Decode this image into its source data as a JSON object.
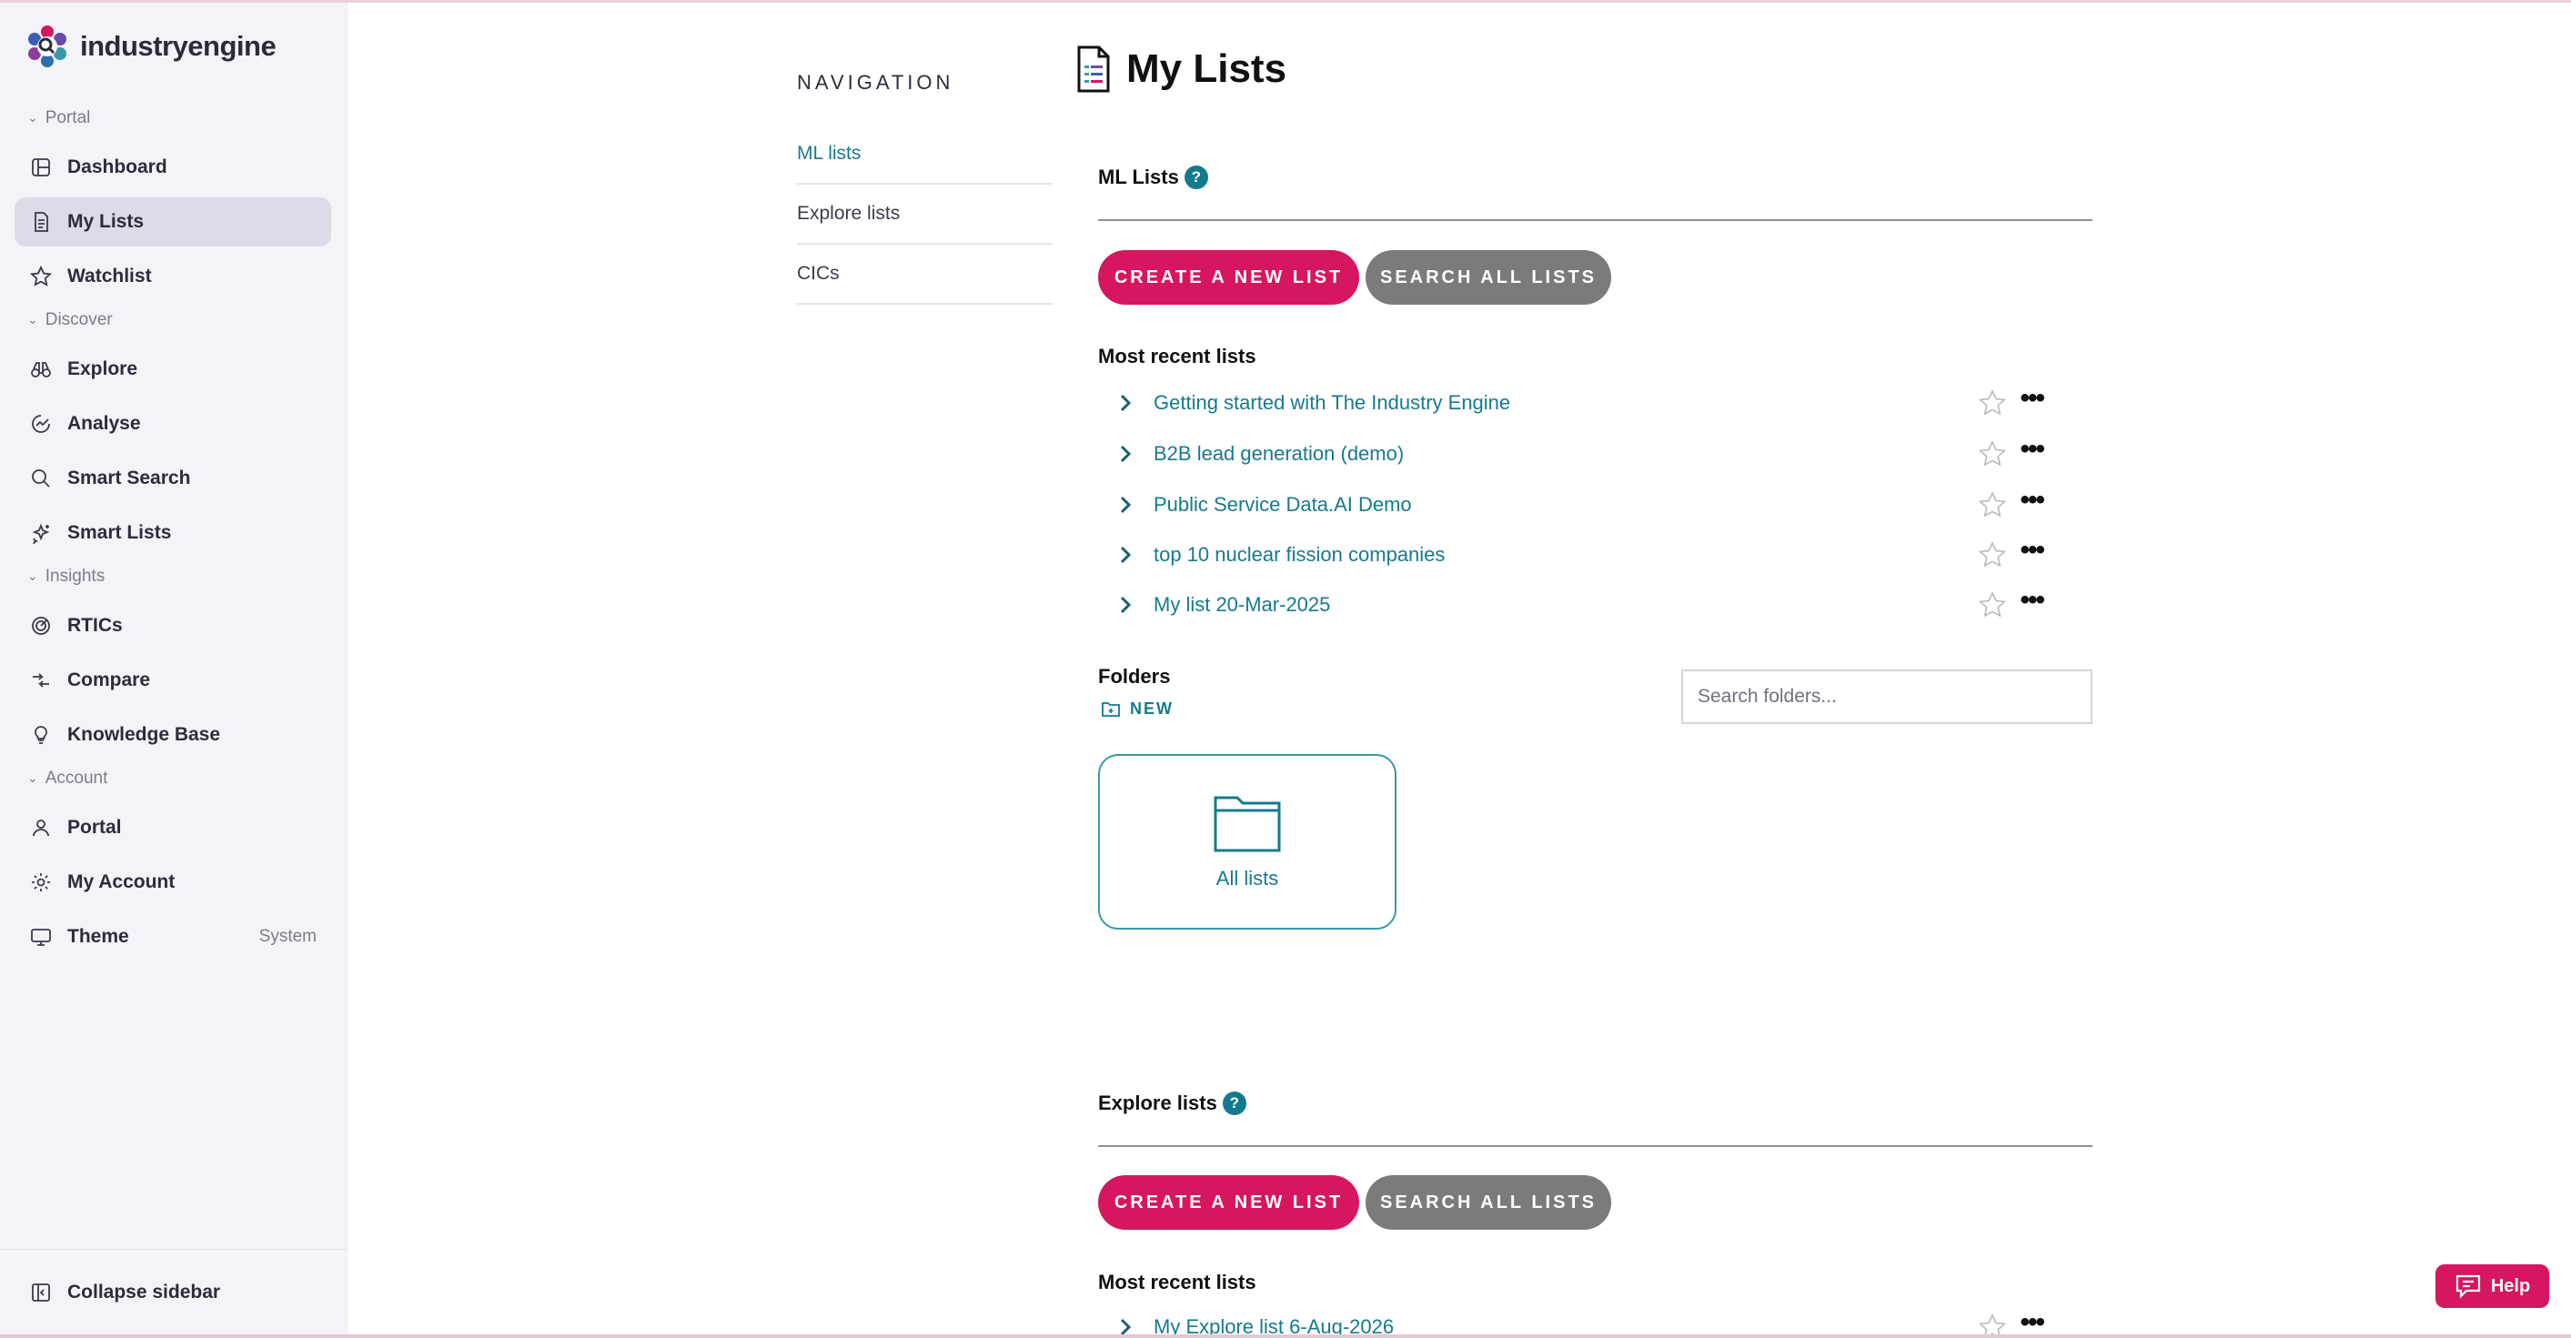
{
  "brand": {
    "name": "industryengine"
  },
  "sidebar": {
    "sections": [
      {
        "label": "Portal"
      },
      {
        "label": "Discover"
      },
      {
        "label": "Insights"
      },
      {
        "label": "Account"
      }
    ],
    "items": [
      {
        "label": "Dashboard",
        "icon": "dashboard-icon"
      },
      {
        "label": "My Lists",
        "icon": "document-icon",
        "active": true
      },
      {
        "label": "Watchlist",
        "icon": "star-icon"
      },
      {
        "label": "Explore",
        "icon": "binoculars-icon"
      },
      {
        "label": "Analyse",
        "icon": "chart-icon"
      },
      {
        "label": "Smart Search",
        "icon": "search-icon"
      },
      {
        "label": "Smart Lists",
        "icon": "sparkles-icon"
      },
      {
        "label": "RTICs",
        "icon": "radar-icon"
      },
      {
        "label": "Compare",
        "icon": "compare-icon"
      },
      {
        "label": "Knowledge Base",
        "icon": "lightbulb-icon"
      },
      {
        "label": "Portal",
        "icon": "users-icon"
      },
      {
        "label": "My Account",
        "icon": "gear-icon"
      },
      {
        "label": "Theme",
        "icon": "monitor-icon",
        "value": "System"
      }
    ],
    "collapse_label": "Collapse sidebar"
  },
  "inner_nav": {
    "title": "NAVIGATION",
    "links": [
      "ML lists",
      "Explore lists",
      "CICs"
    ]
  },
  "page": {
    "title": "My Lists"
  },
  "ml_lists": {
    "heading": "ML Lists",
    "create_label": "CREATE A NEW LIST",
    "search_label": "SEARCH ALL LISTS",
    "recent_heading": "Most recent lists",
    "recent": [
      "Getting started with The Industry Engine",
      "B2B lead generation (demo)",
      "Public Service Data.AI Demo",
      "top 10 nuclear fission companies",
      "My list 20-Mar-2025"
    ]
  },
  "folders": {
    "heading": "Folders",
    "new_label": "NEW",
    "search_placeholder": "Search folders...",
    "cards": [
      "All lists"
    ]
  },
  "explore_lists": {
    "heading": "Explore lists",
    "create_label": "CREATE A NEW LIST",
    "search_label": "SEARCH ALL LISTS",
    "recent_heading": "Most recent lists",
    "recent": [
      "My Explore list 6-Aug-2026"
    ]
  },
  "help": {
    "label": "Help"
  },
  "colors": {
    "accent": "#d6165e",
    "teal": "#167a8e",
    "secondary": "#7b7b7b"
  }
}
